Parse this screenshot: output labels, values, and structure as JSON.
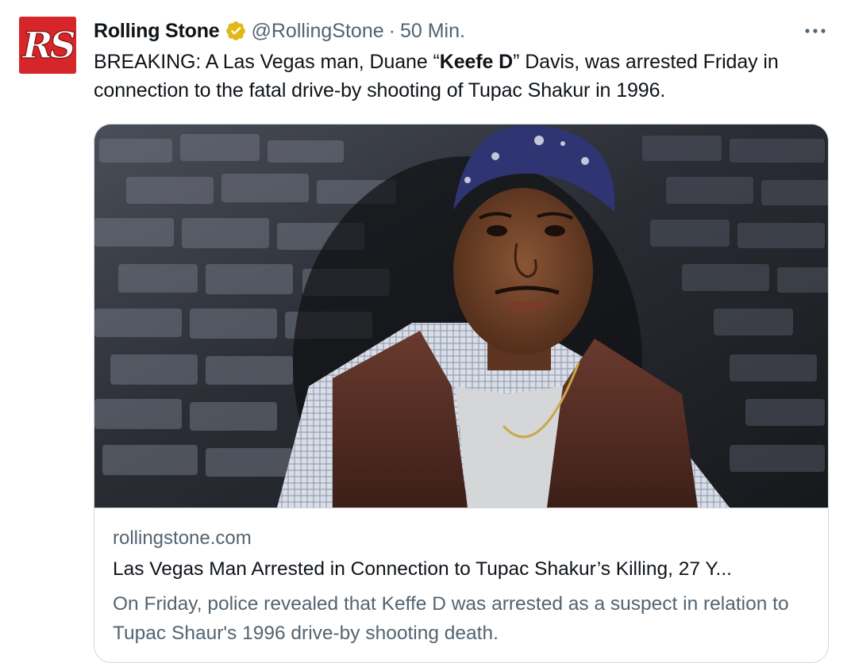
{
  "tweet": {
    "author": {
      "avatar_text": "RS",
      "display_name": "Rolling Stone",
      "verified_icon": "verified-badge-gold-icon",
      "handle": "@RollingStone",
      "separator": "·",
      "time": "50 Min."
    },
    "more_icon": "ellipsis-icon",
    "text": {
      "part1": "BREAKING: A Las Vegas man, Duane “",
      "bold": "Keefe D",
      "part2": "” Davis, was arrested Friday in connection to the fatal drive-by shooting of Tupac Shakur in 1996."
    },
    "card": {
      "image_alt": "Tupac Shakur wearing a blue bandana and leather vest in front of a brick wall",
      "domain": "rollingstone.com",
      "title": "Las Vegas Man Arrested in Connection to Tupac Shakur’s Killing, 27 Y...",
      "description": "On Friday, police revealed that Keffe D was arrested as a suspect in relation to Tupac Shaur's 1996 drive-by shooting death."
    }
  },
  "colors": {
    "brand_red": "#d7262a",
    "verified_gold": "#e2b719",
    "secondary_text": "#536471",
    "primary_text": "#0f1419",
    "border": "#cfd9de"
  }
}
